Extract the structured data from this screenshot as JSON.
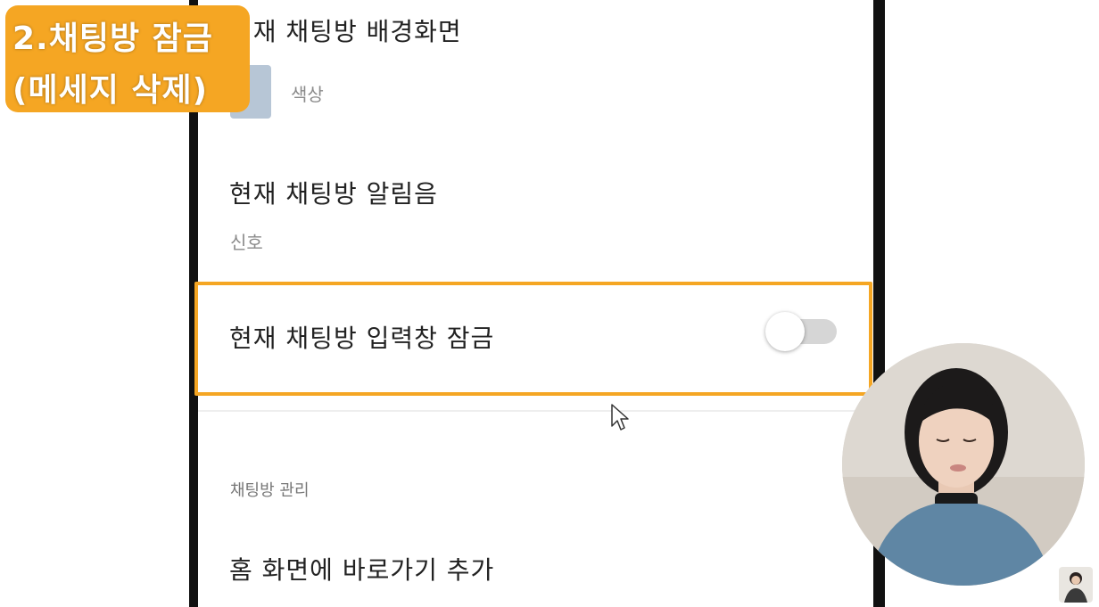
{
  "caption": {
    "line1": "2.채팅방 잠금",
    "line2": "(메세지 삭제)"
  },
  "settings": {
    "background": {
      "title": "현재 채팅방 배경화면",
      "value": "색상",
      "swatch_color": "#b7c6d6"
    },
    "notification": {
      "title": "현재 채팅방 알림음",
      "value": "신호"
    },
    "input_lock": {
      "title": "현재 채팅방 입력창 잠금",
      "toggle_on": false
    }
  },
  "management": {
    "header": "채팅방 관리",
    "shortcut_label": "홈 화면에 바로가기 추가"
  },
  "colors": {
    "accent": "#f5a623",
    "toggle_track": "#d6d6d6"
  },
  "icons": {
    "cursor": "mouse-pointer-icon"
  }
}
